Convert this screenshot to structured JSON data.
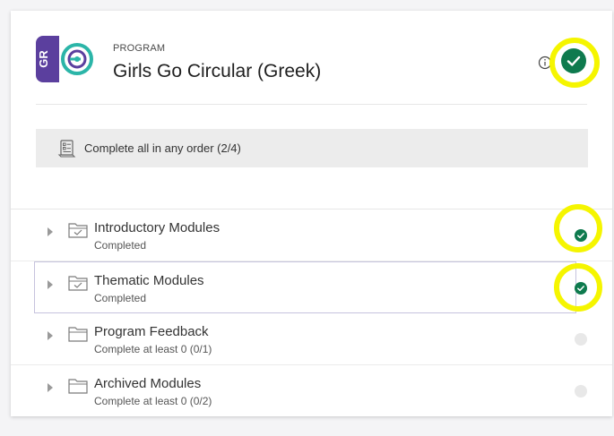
{
  "header": {
    "kicker": "PROGRAM",
    "title": "Girls Go Circular (Greek)",
    "logo_text": "GR",
    "logo_color": "#5b3f9e",
    "logo_accent": "#2bb5a8"
  },
  "completion": {
    "label": "Complete all in any order (2/4)"
  },
  "modules": [
    {
      "title": "Introductory Modules",
      "status": "Completed",
      "done": true
    },
    {
      "title": "Thematic Modules",
      "status": "Completed",
      "done": true,
      "selected": true
    },
    {
      "title": "Program Feedback",
      "status": "Complete at least 0 (0/1)",
      "done": false
    },
    {
      "title": "Archived Modules",
      "status": "Complete at least 0 (0/2)",
      "done": false
    }
  ],
  "colors": {
    "check_green": "#0e7a4e",
    "highlight": "#f5f500"
  },
  "icons": [
    "info-icon",
    "check-circle-icon",
    "document-list-icon",
    "folder-check-icon",
    "folder-icon",
    "caret-right-icon"
  ]
}
